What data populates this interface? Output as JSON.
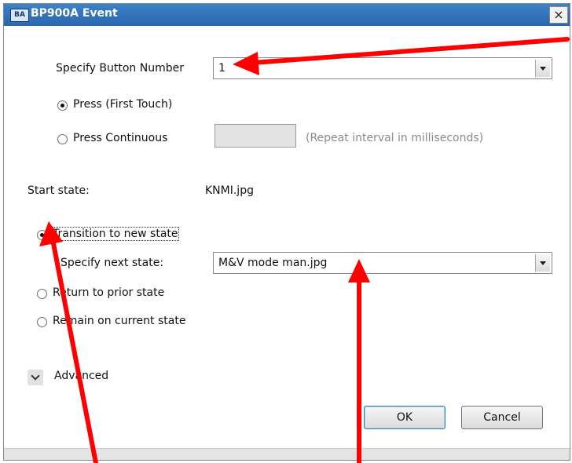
{
  "window": {
    "title": "BP900A Event",
    "app_icon": "BA",
    "close_glyph": "×"
  },
  "form": {
    "button_number_label": "Specify Button Number",
    "button_number_value": "1",
    "press_first_label": "Press (First Touch)",
    "press_continuous_label": "Press Continuous",
    "repeat_interval_value": "",
    "repeat_interval_hint": "(Repeat interval in milliseconds)",
    "start_state_label": "Start state:",
    "start_state_value": "KNMI.jpg",
    "transition_label": "Transition to new state",
    "next_state_label": "Specify next state:",
    "next_state_value": "M&V mode man.jpg",
    "return_label": "Return to prior state",
    "remain_label": "Remain on current state",
    "advanced_label": "Advanced"
  },
  "buttons": {
    "ok": "OK",
    "cancel": "Cancel"
  },
  "state": {
    "press_mode": "first_touch",
    "state_mode": "transition"
  },
  "colors": {
    "titlebar": "#2f73ba",
    "annotation_arrow": "#ff0000"
  }
}
